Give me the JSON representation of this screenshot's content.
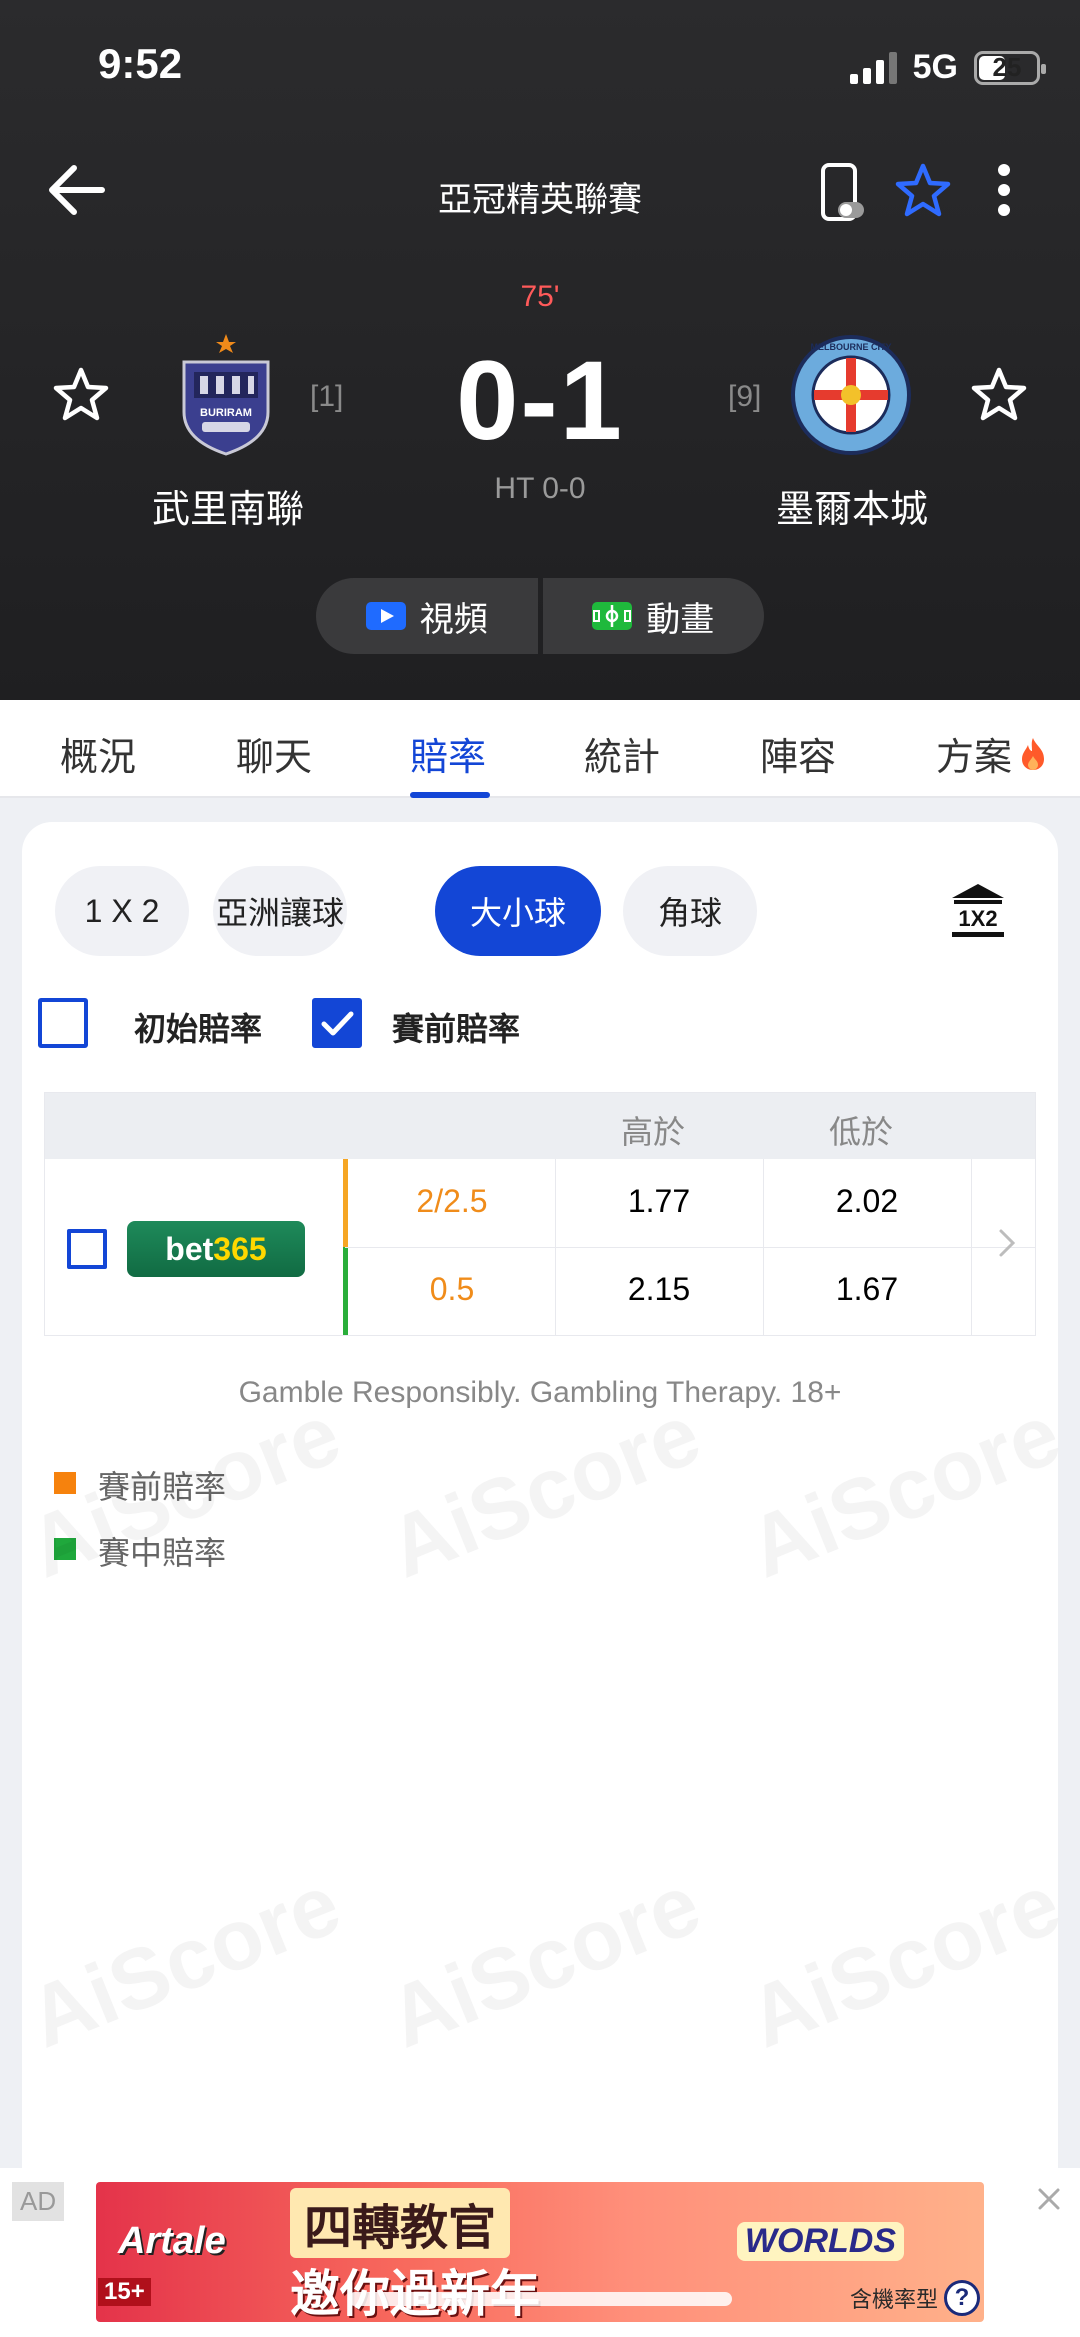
{
  "status": {
    "time": "9:52",
    "network": "5G",
    "battery": "25"
  },
  "header": {
    "league": "亞冠精英聯賽",
    "minute": "75'",
    "score": "0-1",
    "halftime": "HT 0-0",
    "home": {
      "name": "武里南聯",
      "rank": "[1]",
      "logo_text": "BURIRAM"
    },
    "away": {
      "name": "墨爾本城",
      "rank": "[9]",
      "logo_text": "MELBOURNE CITY"
    },
    "video_label": "視頻",
    "animation_label": "動畫"
  },
  "tabs": [
    "概況",
    "聊天",
    "賠率",
    "統計",
    "陣容",
    "方案"
  ],
  "active_tab": "賠率",
  "odds": {
    "market_chips": [
      "1 X 2",
      "亞洲讓球",
      "大小球",
      "角球"
    ],
    "active_chip": "大小球",
    "filters": {
      "initial_label": "初始賠率",
      "initial_checked": false,
      "pre_label": "賽前賠率",
      "pre_checked": true
    },
    "columns": {
      "over": "高於",
      "under": "低於"
    },
    "bookmaker": {
      "name_part1": "bet",
      "name_part2": "365"
    },
    "rows": [
      {
        "line": "2/2.5",
        "over": "1.77",
        "under": "2.02",
        "type": "pre"
      },
      {
        "line": "0.5",
        "over": "2.15",
        "under": "1.67",
        "type": "live"
      }
    ],
    "disclaimer": "Gamble Responsibly. Gambling Therapy. 18+",
    "legend": [
      {
        "label": "賽前賠率",
        "color": "#f6820d"
      },
      {
        "label": "賽中賠率",
        "color": "#1fa83c"
      }
    ]
  },
  "watermark": "AiScore",
  "ad": {
    "tag": "AD",
    "brand": "Artale",
    "line1": "四轉教官",
    "line2": "邀你過新年",
    "worlds": "WORLDS",
    "sub": "含機率型",
    "age": "15+",
    "help": "?"
  }
}
